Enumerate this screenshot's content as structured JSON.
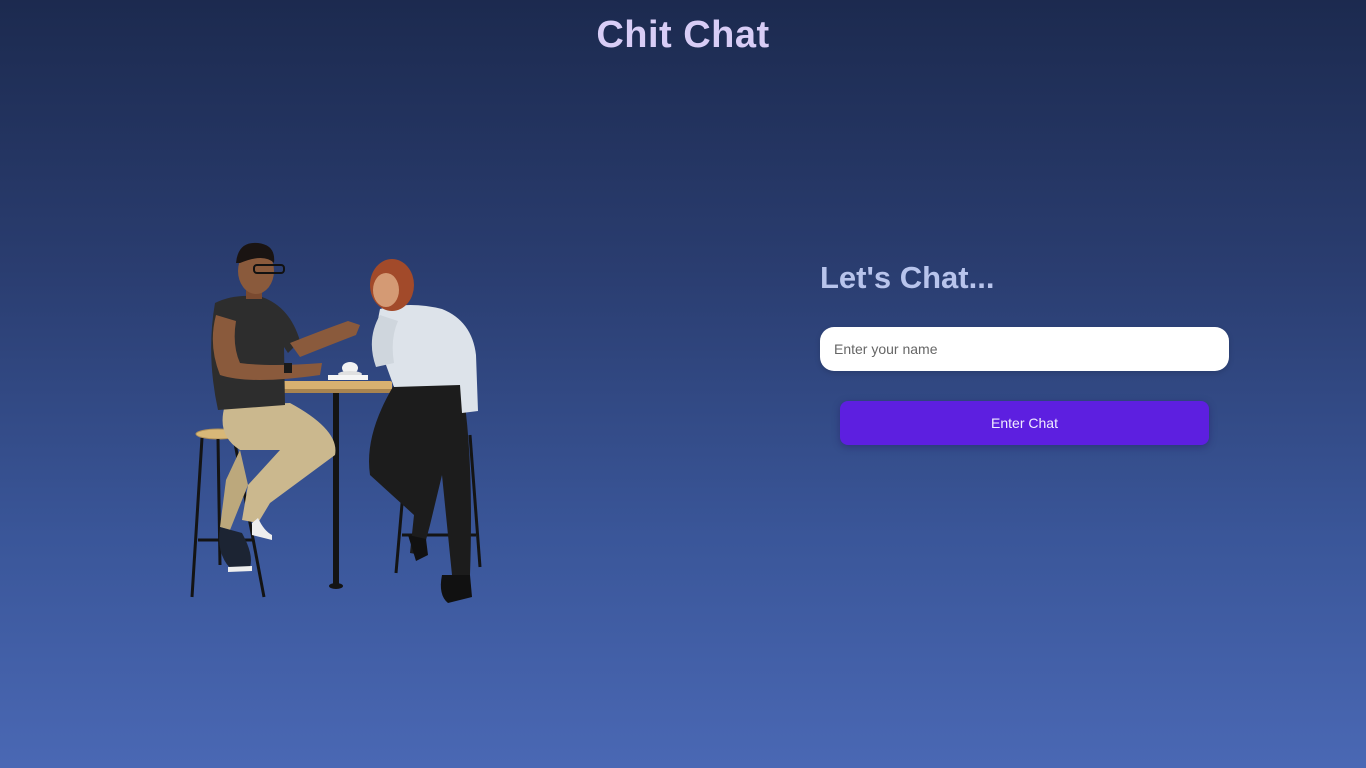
{
  "header": {
    "title": "Chit Chat"
  },
  "form": {
    "heading": "Let's Chat...",
    "name_input": {
      "placeholder": "Enter your name",
      "value": ""
    },
    "submit_label": "Enter Chat"
  },
  "illustration": {
    "icon": "two-people-chatting-at-table-illustration"
  },
  "colors": {
    "title": "#d8cdf6",
    "heading": "#b8c4ec",
    "button": "#5d1fe0",
    "background_top": "#1c2a4f",
    "background_bottom": "#4a68b4"
  }
}
